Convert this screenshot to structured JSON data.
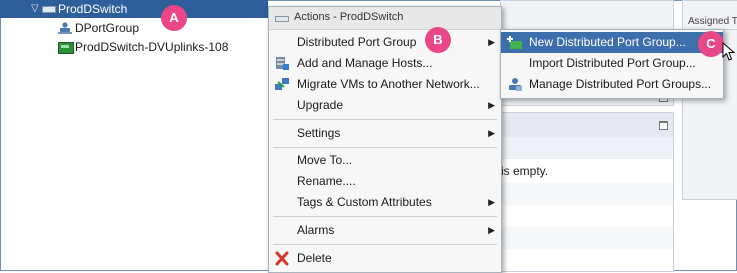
{
  "tree": {
    "selected_switch": "ProdDSwitch",
    "items": [
      {
        "label": "DPortGroup",
        "icon": "port-group-icon"
      },
      {
        "label": "ProdDSwitch-DVUplinks-108",
        "icon": "uplinks-icon"
      }
    ]
  },
  "badges": {
    "a": "A",
    "b": "B",
    "c": "C"
  },
  "background": {
    "empty_text": "is empty.",
    "assigned_label": "Assigned T"
  },
  "menu": {
    "header": "Actions - ProdDSwitch",
    "items": [
      {
        "label": "Distributed Port Group",
        "submenu": true
      },
      {
        "label": "Add and Manage Hosts...",
        "icon": "add-hosts-icon"
      },
      {
        "label": "Migrate VMs to Another Network...",
        "icon": "migrate-icon"
      },
      {
        "label": "Upgrade",
        "submenu": true
      },
      {
        "label": "Settings",
        "submenu": true
      },
      {
        "label": "Move To..."
      },
      {
        "label": "Rename...."
      },
      {
        "label": "Tags & Custom Attributes",
        "submenu": true
      },
      {
        "label": "Alarms",
        "submenu": true
      },
      {
        "label": "Delete",
        "icon": "delete-icon"
      }
    ]
  },
  "submenu": {
    "items": [
      {
        "label": "New Distributed Port Group...",
        "active": true
      },
      {
        "label": "Import Distributed Port Group..."
      },
      {
        "label": "Manage Distributed Port Groups..."
      }
    ]
  },
  "colors": {
    "selection": "#2e5f9a",
    "badge": "#e94787",
    "submenu_active": "#3e6fad",
    "delete_icon": "#d9342b"
  }
}
